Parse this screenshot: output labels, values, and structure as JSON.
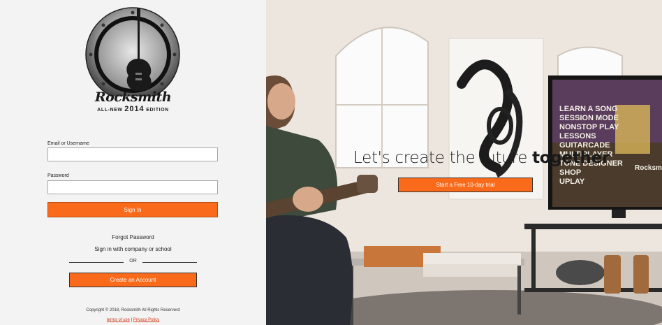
{
  "logo": {
    "wordmark": "Rocksmith",
    "edition_pre": "ALL-NEW",
    "edition_year": "2014",
    "edition_post": "EDITION"
  },
  "form": {
    "email_label": "Email or Username",
    "email_value": "",
    "password_label": "Password",
    "password_value": "",
    "signin_label": "Sign In"
  },
  "links": {
    "forgot": "Forgot Password",
    "sso": "Sign in with company or school",
    "or": "OR",
    "create": "Create an Account"
  },
  "footer": {
    "copyright": "Copyright © 2018, Rocksmith All Rights Reserverd",
    "terms": "terms of use",
    "separator": "|",
    "privacy": "Privacy Policy"
  },
  "hero": {
    "headline_light": "Let's create the future ",
    "headline_bold": "together",
    "trial_label": "Start a Free 10-day trial"
  },
  "tv_menu": {
    "items": [
      "LEARN A SONG",
      "SESSION MODE",
      "NONSTOP PLAY",
      "LESSONS",
      "GUITARCADE",
      "MULTIPLAYER",
      "TONE DESIGNER",
      "SHOP",
      "UPLAY"
    ],
    "brand": "Rocksm"
  },
  "colors": {
    "accent": "#f96a1a",
    "link": "#d43a1a",
    "background": "#f3f3f3"
  }
}
